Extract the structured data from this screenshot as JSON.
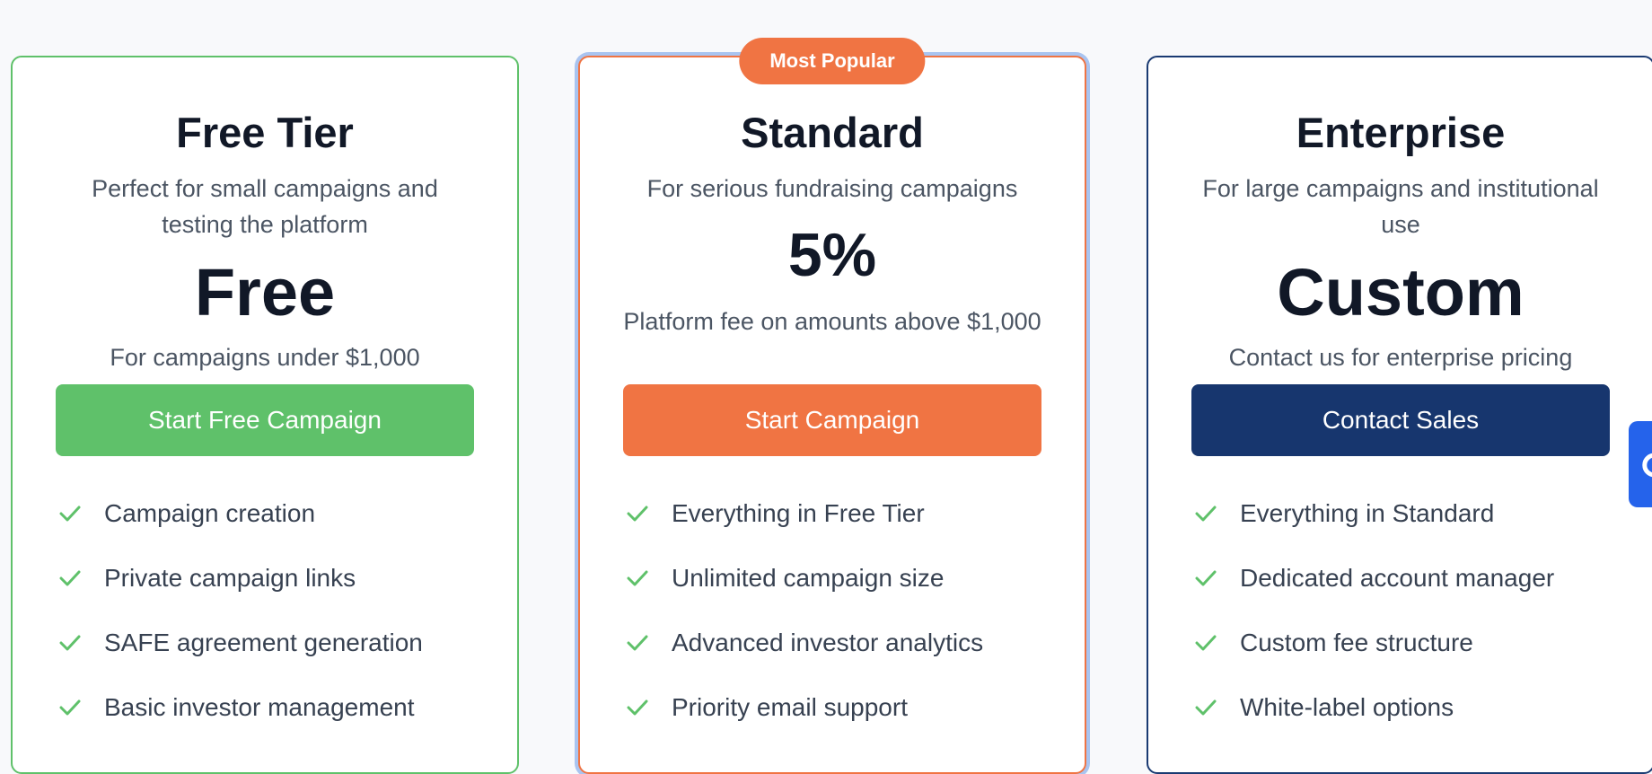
{
  "plans": [
    {
      "name": "Free Tier",
      "description": "Perfect for small campaigns and testing the platform",
      "price": "Free",
      "price_note": "For campaigns under $1,000",
      "cta": "Start Free Campaign",
      "accent_color": "#5fc16a",
      "features": [
        "Campaign creation",
        "Private campaign links",
        "SAFE agreement generation",
        "Basic investor management"
      ]
    },
    {
      "name": "Standard",
      "badge": "Most Popular",
      "description": "For serious fundraising campaigns",
      "price": "5%",
      "price_note": "Platform fee on amounts above $1,000",
      "cta": "Start Campaign",
      "accent_color": "#f07443",
      "features": [
        "Everything in Free Tier",
        "Unlimited campaign size",
        "Advanced investor analytics",
        "Priority email support"
      ]
    },
    {
      "name": "Enterprise",
      "description": "For large campaigns and institutional use",
      "price": "Custom",
      "price_note": "Contact us for enterprise pricing",
      "cta": "Contact Sales",
      "accent_color": "#17366e",
      "features": [
        "Everything in Standard",
        "Dedicated account manager",
        "Custom fee structure",
        "White-label options"
      ]
    }
  ],
  "icons": {
    "feature_check": "check-icon",
    "floating_button": "chat-icon"
  },
  "colors": {
    "check": "#5fc16a",
    "highlight_ring": "#a9c4f0",
    "floating_button": "#2563eb"
  }
}
